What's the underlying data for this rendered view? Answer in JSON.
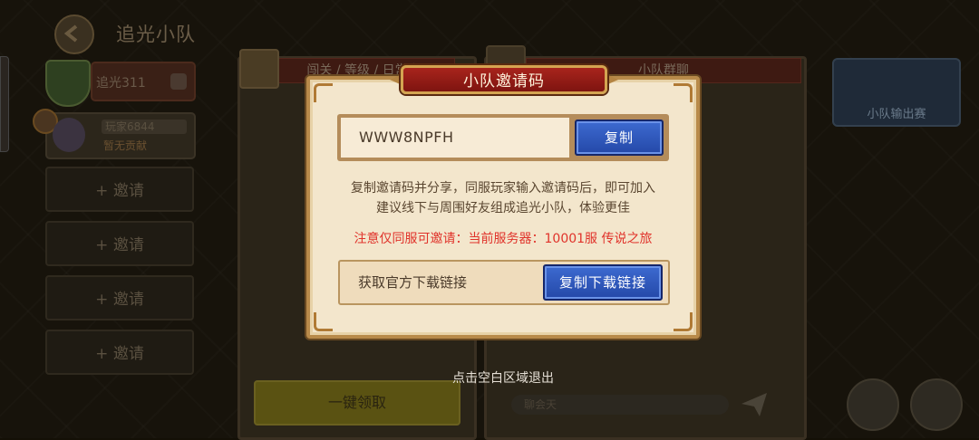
{
  "header": {
    "title": "追光小队"
  },
  "team": {
    "name": "追光311"
  },
  "member": {
    "name": "玩家6844",
    "contribution": "暂无贡献"
  },
  "invite_slots": [
    {
      "label": "+ 邀请"
    },
    {
      "label": "+ 邀请"
    },
    {
      "label": "+ 邀请"
    },
    {
      "label": "+ 邀请"
    }
  ],
  "rewards_panel": {
    "header": "闯关 / 等级 / 日常宝",
    "claim_all": "一键领取"
  },
  "chat_panel": {
    "header": "小队群聊",
    "placeholder": "聊会天"
  },
  "tournament": {
    "label": "小队输出赛"
  },
  "modal": {
    "title": "小队邀请码",
    "invite_code": "WWW8NPFH",
    "copy_button": "复制",
    "desc_line1": "复制邀请码并分享，同服玩家输入邀请码后，即可加入",
    "desc_line2": "建议线下与周围好友组成追光小队，体验更佳",
    "notice": "注意仅同服可邀请：当前服务器：10001服  传说之旅",
    "download_label": "获取官方下载链接",
    "download_button": "复制下载链接"
  },
  "exit_hint": "点击空白区域退出",
  "colors": {
    "modal_bg": "#f3e6cc",
    "title_red": "#8e1a14",
    "button_blue": "#2e56bc",
    "notice_red": "#e0322a"
  }
}
